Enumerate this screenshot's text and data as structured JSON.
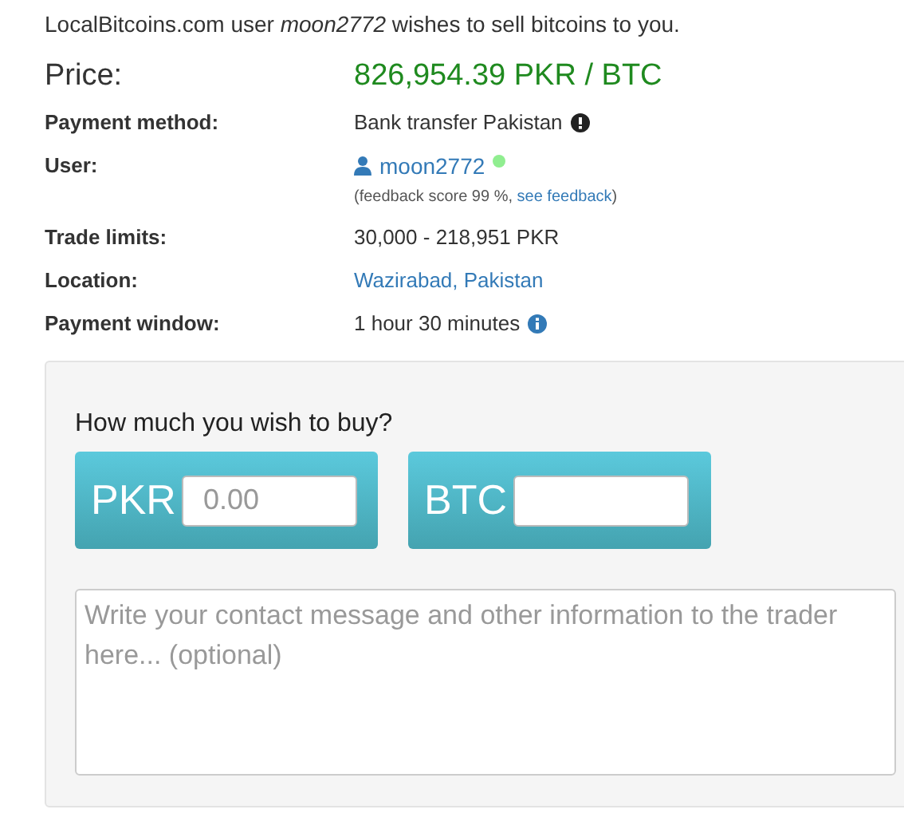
{
  "intro": "LocalBitcoins.com user *moon2772* wishes to sell bitcoins to you.",
  "details": [
    {
      "kind": "price",
      "label": "Price:",
      "value": "826,954.39 PKR / BTC"
    },
    {
      "kind": "warning",
      "label": "Payment method:",
      "value": "Bank transfer Pakistan"
    },
    {
      "kind": "user",
      "label": "User:",
      "value": "moon2772",
      "online": true,
      "feedback": "(feedback score 99 %, ",
      "feedback_link": "see feedback",
      "feedback_end": ")"
    },
    {
      "kind": "text",
      "label": "Trade limits:",
      "value": "30,000 - 218,951 PKR"
    },
    {
      "kind": "link",
      "label": "Location:",
      "value": "Wazirabad, Pakistan"
    },
    {
      "kind": "info",
      "label": "Payment window:",
      "value": "1 hour 30 minutes"
    }
  ],
  "form": {
    "question": "How much you wish to buy?",
    "amounts": [
      {
        "currency": "PKR",
        "placeholder": "0.00"
      },
      {
        "currency": "BTC"
      }
    ],
    "message": {
      "placeholder": "Write your contact message and other information to the trader here... (optional)"
    }
  }
}
